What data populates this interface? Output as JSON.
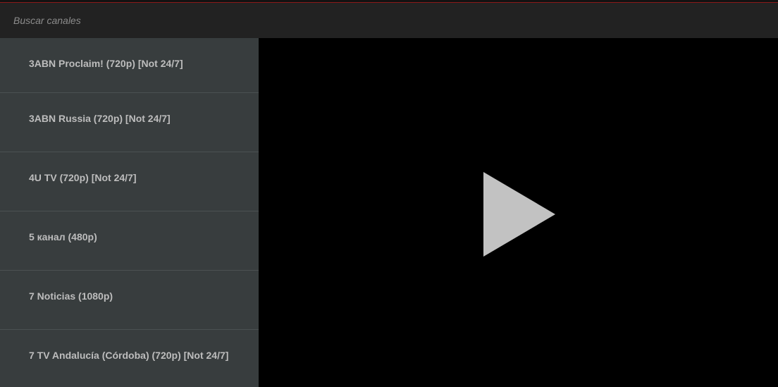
{
  "search": {
    "placeholder": "Buscar canales",
    "value": ""
  },
  "channels": [
    {
      "label": "3ABN Proclaim! (720p) [Not 24/7]"
    },
    {
      "label": "3ABN Russia (720p) [Not 24/7]"
    },
    {
      "label": "4U TV (720p) [Not 24/7]"
    },
    {
      "label": "5 канал (480p)"
    },
    {
      "label": "7 Noticias (1080p)"
    },
    {
      "label": "7 TV Andalucía (Córdoba) (720p) [Not 24/7]"
    }
  ],
  "player": {
    "play_icon": "play-icon"
  },
  "colors": {
    "accent": "#8a1a1a",
    "search_bg": "#222222",
    "list_bg": "#383d3e",
    "list_divider": "#4b5152",
    "item_text": "#bdbdbd",
    "player_bg": "#000000",
    "play_icon": "#c2c2c2"
  }
}
